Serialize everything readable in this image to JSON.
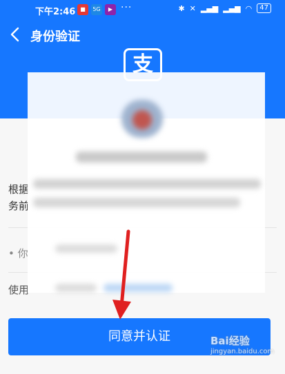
{
  "status_bar": {
    "time": "下午2:46",
    "battery": "47",
    "more": "···"
  },
  "nav": {
    "title": "身份验证"
  },
  "header": {
    "logo_char": "支"
  },
  "content": {
    "line1_start": "根据",
    "line2_start": "务前",
    "bullet_start": "• 你",
    "use_start": "使用"
  },
  "primary_button": {
    "label": "同意并认证"
  },
  "watermark": {
    "brand": "Bai经验",
    "url": "jingyan.baidu.com"
  },
  "colors": {
    "brand_blue": "#1677ff",
    "arrow_red": "#e02020"
  }
}
